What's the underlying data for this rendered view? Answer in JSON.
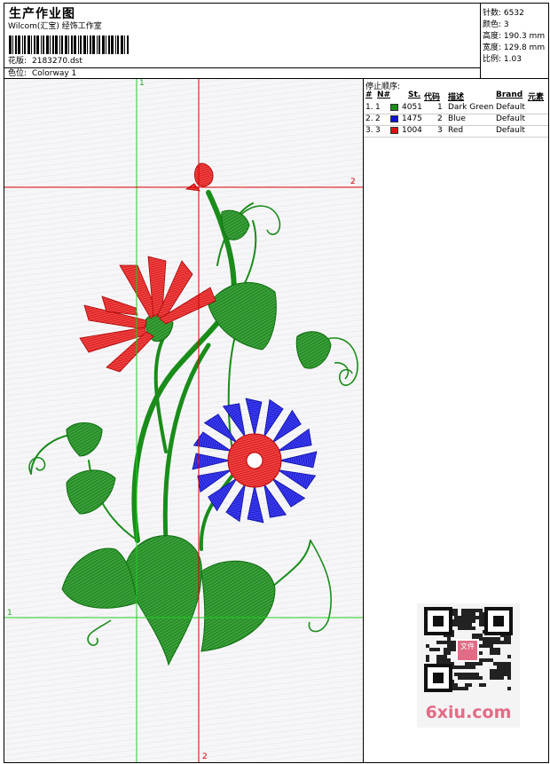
{
  "header": {
    "title": "生产作业图",
    "subtitle": "Wilcom(汇宝) 经饰工作室",
    "design_label": "花版:",
    "design_value": "2183270.dst",
    "color_label": "色位:",
    "color_value": "Colorway 1"
  },
  "stats": {
    "stitches_label": "针数:",
    "stitches_value": "6532",
    "colors_label": "颜色:",
    "colors_value": "3",
    "height_label": "高度:",
    "height_value": "190.3 mm",
    "width_label": "宽度:",
    "width_value": "129.8 mm",
    "scale_label": "比例:",
    "scale_value": "1.03"
  },
  "stop_sequence": {
    "title": "停止顺序:",
    "columns": [
      "#",
      "N#",
      "St.",
      "代码",
      "描述",
      "Brand",
      "元素"
    ],
    "rows": [
      {
        "idx": "1.",
        "n": "1",
        "stitches": "4051",
        "code": "1",
        "desc": "Dark Green",
        "brand": "Default",
        "color": "#1a8c1a"
      },
      {
        "idx": "2.",
        "n": "2",
        "stitches": "1475",
        "code": "2",
        "desc": "Blue",
        "brand": "Default",
        "color": "#1010d8"
      },
      {
        "idx": "3.",
        "n": "3",
        "stitches": "1004",
        "code": "3",
        "desc": "Red",
        "brand": "Default",
        "color": "#e01010"
      }
    ]
  },
  "guides": {
    "v1_label": "1",
    "v2_label": "2",
    "h1_label": "1",
    "h2_label": "2"
  },
  "colors": {
    "green": "#1a8c1a",
    "blue": "#1212d6",
    "red": "#e81616",
    "guide_green": "#22cc22",
    "guide_red": "#dd0000"
  },
  "watermark": {
    "text": "6xiu.com",
    "qr_badge": "文件"
  }
}
